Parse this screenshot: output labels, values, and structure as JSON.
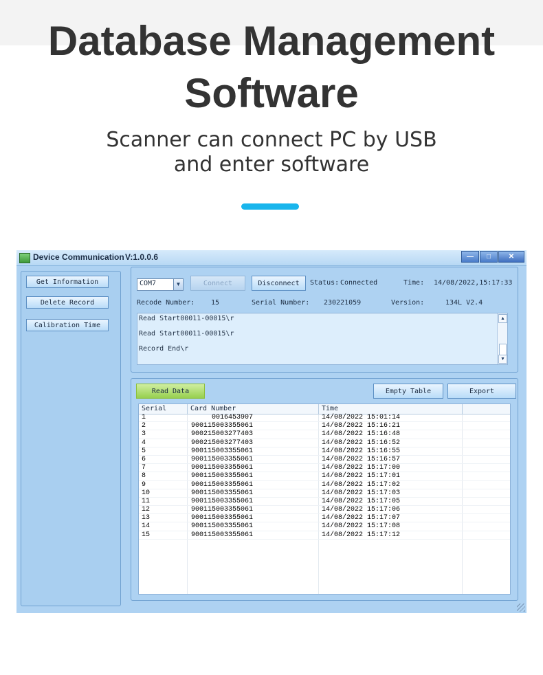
{
  "heading": {
    "line1": "Database Management",
    "line2": "Software",
    "sub1": "Scanner can connect PC by USB",
    "sub2": "and enter software",
    "accent_color": "#19b5ec"
  },
  "window": {
    "title": "Device Communication",
    "version": "V:1.0.0.6",
    "controls": {
      "minimize": "—",
      "maximize": "□",
      "close": "✕"
    }
  },
  "sidebar": {
    "items": [
      {
        "label": "Get Information"
      },
      {
        "label": "Delete Record"
      },
      {
        "label": "Calibration Time"
      }
    ]
  },
  "connection": {
    "port": "COM7",
    "connect_label": "Connect",
    "disconnect_label": "Disconnect",
    "status_label": "Status:",
    "status_value": "Connected",
    "time_label": "Time:",
    "time_value": "14/08/2022,15:17:33",
    "record_label": "Recode Number:",
    "record_value": "15",
    "serial_label": "Serial Number:",
    "serial_value": "230221059",
    "version_label": "Version:",
    "version_value": "134L V2.4"
  },
  "log": {
    "lines": [
      "Read Start00011-00015\\r",
      "Read Start00011-00015\\r",
      "Record End\\r"
    ]
  },
  "data_panel": {
    "read_label": "Read Data",
    "empty_label": "Empty Table",
    "export_label": "Export",
    "columns": [
      "Serial",
      "Card Number",
      "Time"
    ],
    "rows": [
      {
        "serial": "1",
        "card": "0016453907",
        "time": "14/08/2022 15:01:14"
      },
      {
        "serial": "2",
        "card": "900115003355061",
        "time": "14/08/2022 15:16:21"
      },
      {
        "serial": "3",
        "card": "900215003277403",
        "time": "14/08/2022 15:16:48"
      },
      {
        "serial": "4",
        "card": "900215003277403",
        "time": "14/08/2022 15:16:52"
      },
      {
        "serial": "5",
        "card": "900115003355061",
        "time": "14/08/2022 15:16:55"
      },
      {
        "serial": "6",
        "card": "900115003355061",
        "time": "14/08/2022 15:16:57"
      },
      {
        "serial": "7",
        "card": "900115003355061",
        "time": "14/08/2022 15:17:00"
      },
      {
        "serial": "8",
        "card": "900115003355061",
        "time": "14/08/2022 15:17:01"
      },
      {
        "serial": "9",
        "card": "900115003355061",
        "time": "14/08/2022 15:17:02"
      },
      {
        "serial": "10",
        "card": "900115003355061",
        "time": "14/08/2022 15:17:03"
      },
      {
        "serial": "11",
        "card": "900115003355061",
        "time": "14/08/2022 15:17:05"
      },
      {
        "serial": "12",
        "card": "900115003355061",
        "time": "14/08/2022 15:17:06"
      },
      {
        "serial": "13",
        "card": "900115003355061",
        "time": "14/08/2022 15:17:07"
      },
      {
        "serial": "14",
        "card": "900115003355061",
        "time": "14/08/2022 15:17:08"
      },
      {
        "serial": "15",
        "card": "900115003355061",
        "time": "14/08/2022 15:17:12"
      }
    ]
  }
}
